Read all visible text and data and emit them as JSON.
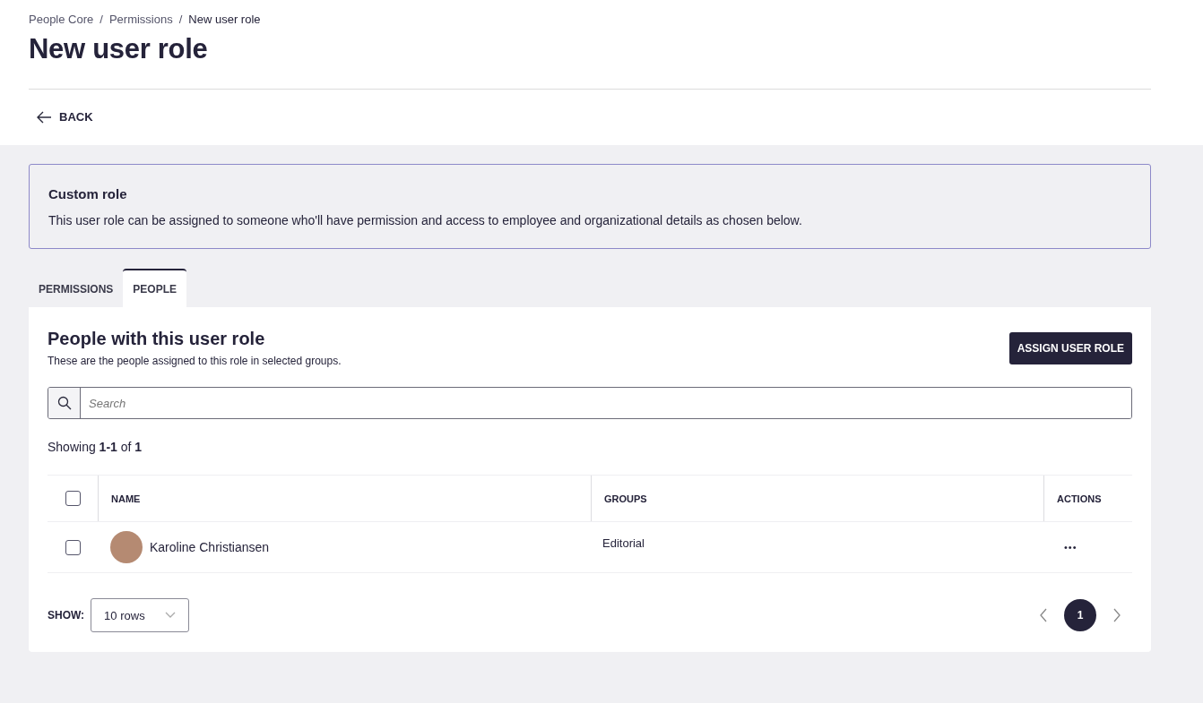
{
  "breadcrumb": {
    "separator": "/",
    "items": [
      {
        "label": "People Core",
        "current": false
      },
      {
        "label": "Permissions",
        "current": false
      },
      {
        "label": "New user role",
        "current": true
      }
    ]
  },
  "title": "New user role",
  "back": {
    "label": "BACK"
  },
  "info": {
    "title": "Custom role",
    "text": "This user role can be assigned to someone who'll have permission and access to employee and organizational details as chosen below."
  },
  "tabs": [
    {
      "label": "PERMISSIONS",
      "selected": false
    },
    {
      "label": "PEOPLE",
      "selected": true
    }
  ],
  "panel": {
    "title": "People with this user role",
    "subtitle": "These are the people assigned to this role in selected groups.",
    "button": "ASSIGN USER ROLE"
  },
  "search": {
    "placeholder": "Search"
  },
  "showing": "Showing **1-1** of **1**",
  "table": {
    "select_all": {
      "checked": false
    },
    "columns": [
      "NAME",
      "GROUPS",
      "ACTIONS"
    ],
    "rows": [
      {
        "checked": false,
        "name": "Karoline Christiansen",
        "groups": "Editorial",
        "actions": "•••"
      }
    ]
  },
  "footer": {
    "show_label": "SHOW:",
    "rows_value": "10 rows",
    "pages": [
      {
        "label": "1",
        "selected": true
      }
    ]
  }
}
